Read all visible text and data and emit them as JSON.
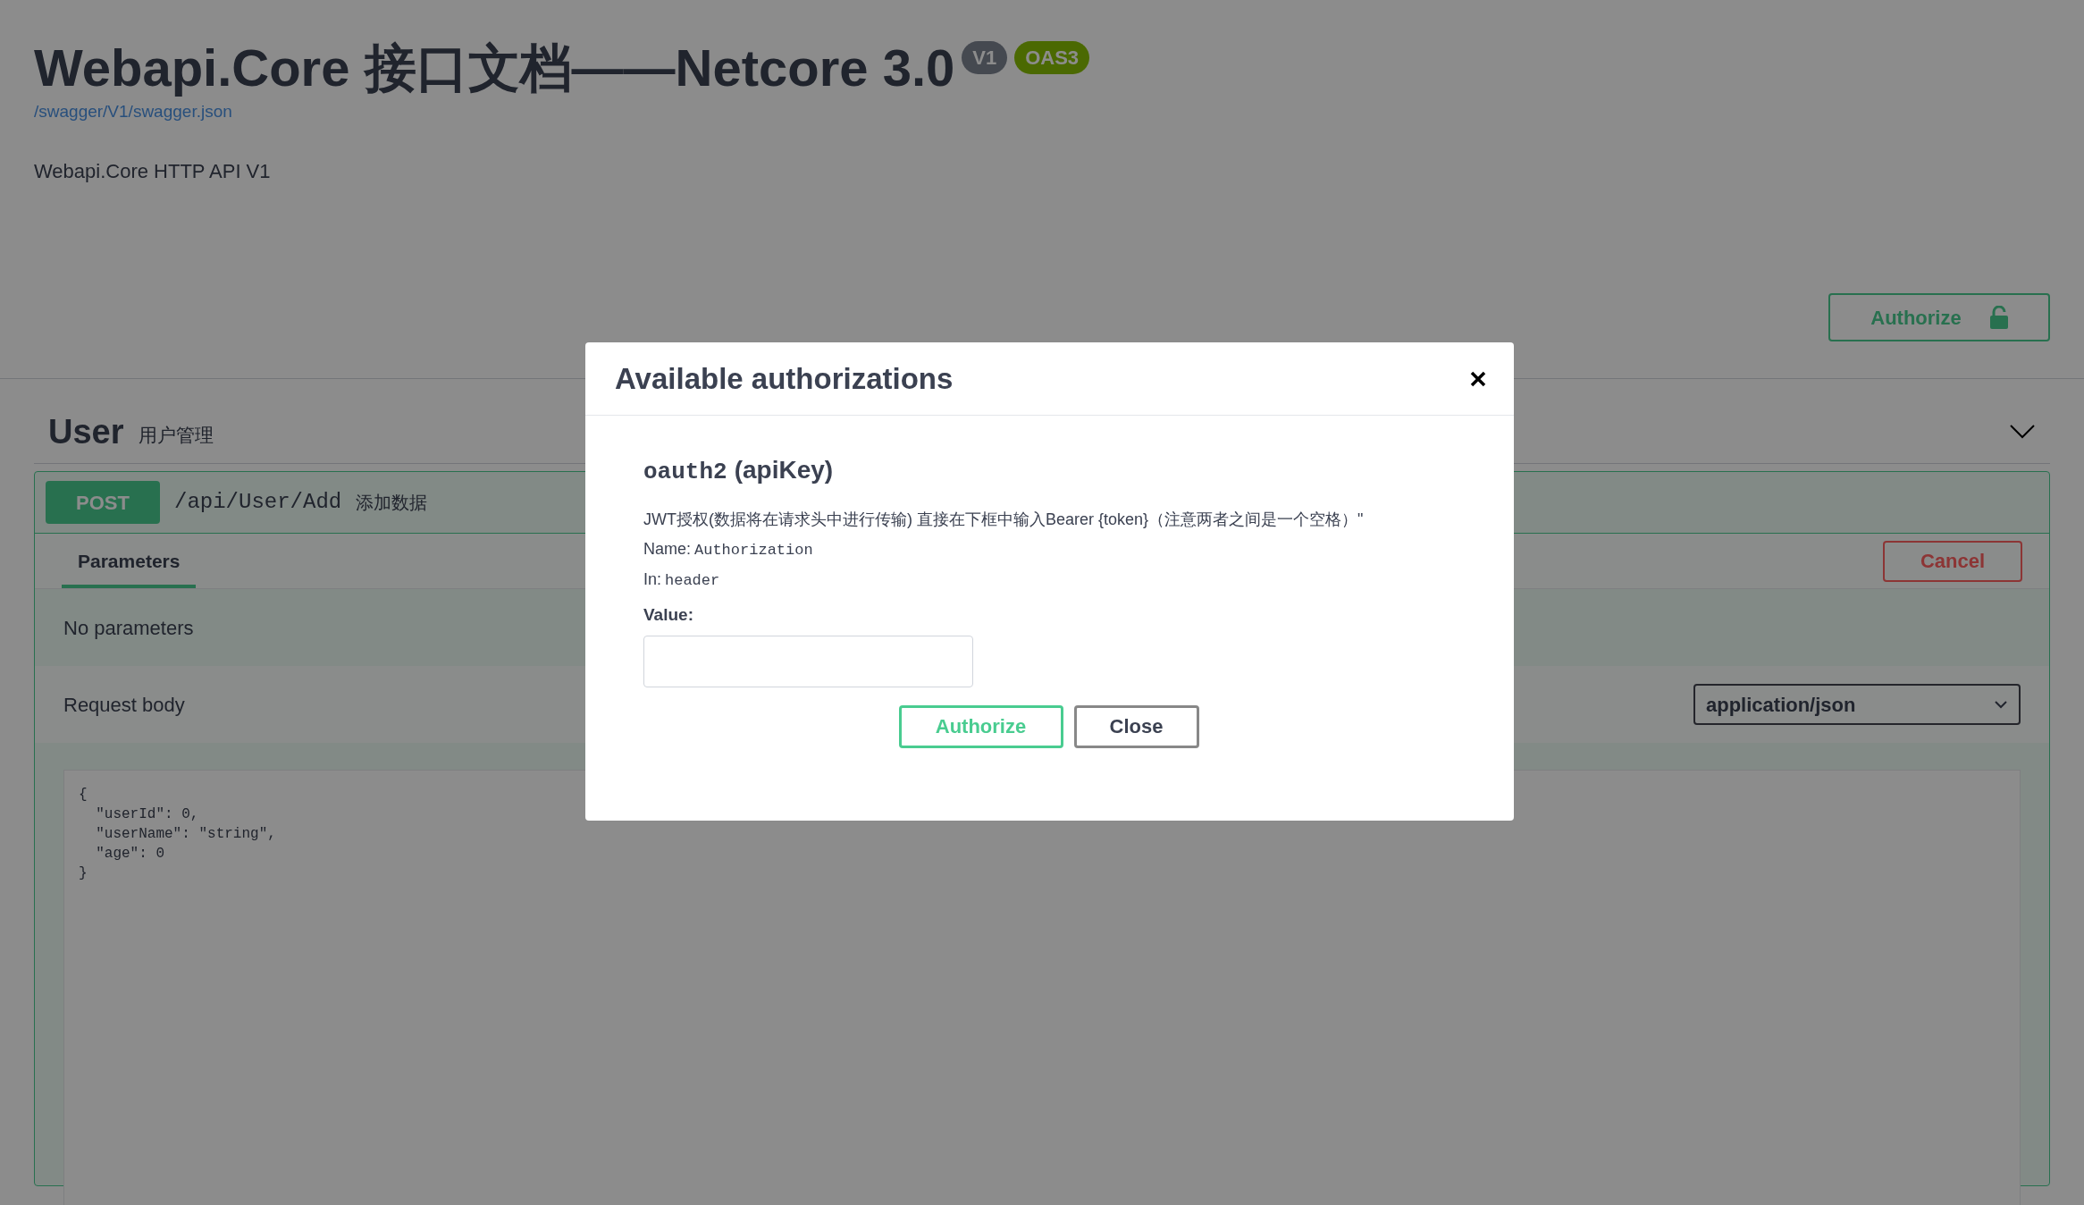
{
  "header": {
    "title": "Webapi.Core 接口文档——Netcore 3.0",
    "badges": [
      {
        "label": "V1",
        "kind": "version"
      },
      {
        "label": "OAS3",
        "kind": "spec"
      }
    ],
    "spec_link": "/swagger/V1/swagger.json",
    "description": "Webapi.Core HTTP API V1"
  },
  "authorize_button": {
    "label": "Authorize"
  },
  "tag": {
    "name": "User",
    "description": "用户管理",
    "expanded": true
  },
  "operation": {
    "method": "POST",
    "path": "/api/User/Add",
    "summary": "添加数据",
    "tabs": [
      {
        "label": "Parameters",
        "selected": true
      }
    ],
    "cancel_button": "Cancel",
    "parameters_message": "No parameters",
    "request_body_label": "Request body",
    "content_type": "application/json",
    "example": "{\n  \"userId\": 0,\n  \"userName\": \"string\",\n  \"age\": 0\n}"
  },
  "modal": {
    "title": "Available authorizations",
    "scheme_name": "oauth2",
    "scheme_type": "(apiKey)",
    "description": "JWT授权(数据将在请求头中进行传输) 直接在下框中输入Bearer {token}（注意两者之间是一个空格）\"",
    "name_label": "Name:",
    "name_value": "Authorization",
    "in_label": "In:",
    "in_value": "header",
    "value_label": "Value:",
    "buttons": [
      {
        "label": "Authorize",
        "kind": "primary"
      },
      {
        "label": "Close",
        "kind": "secondary"
      }
    ]
  }
}
